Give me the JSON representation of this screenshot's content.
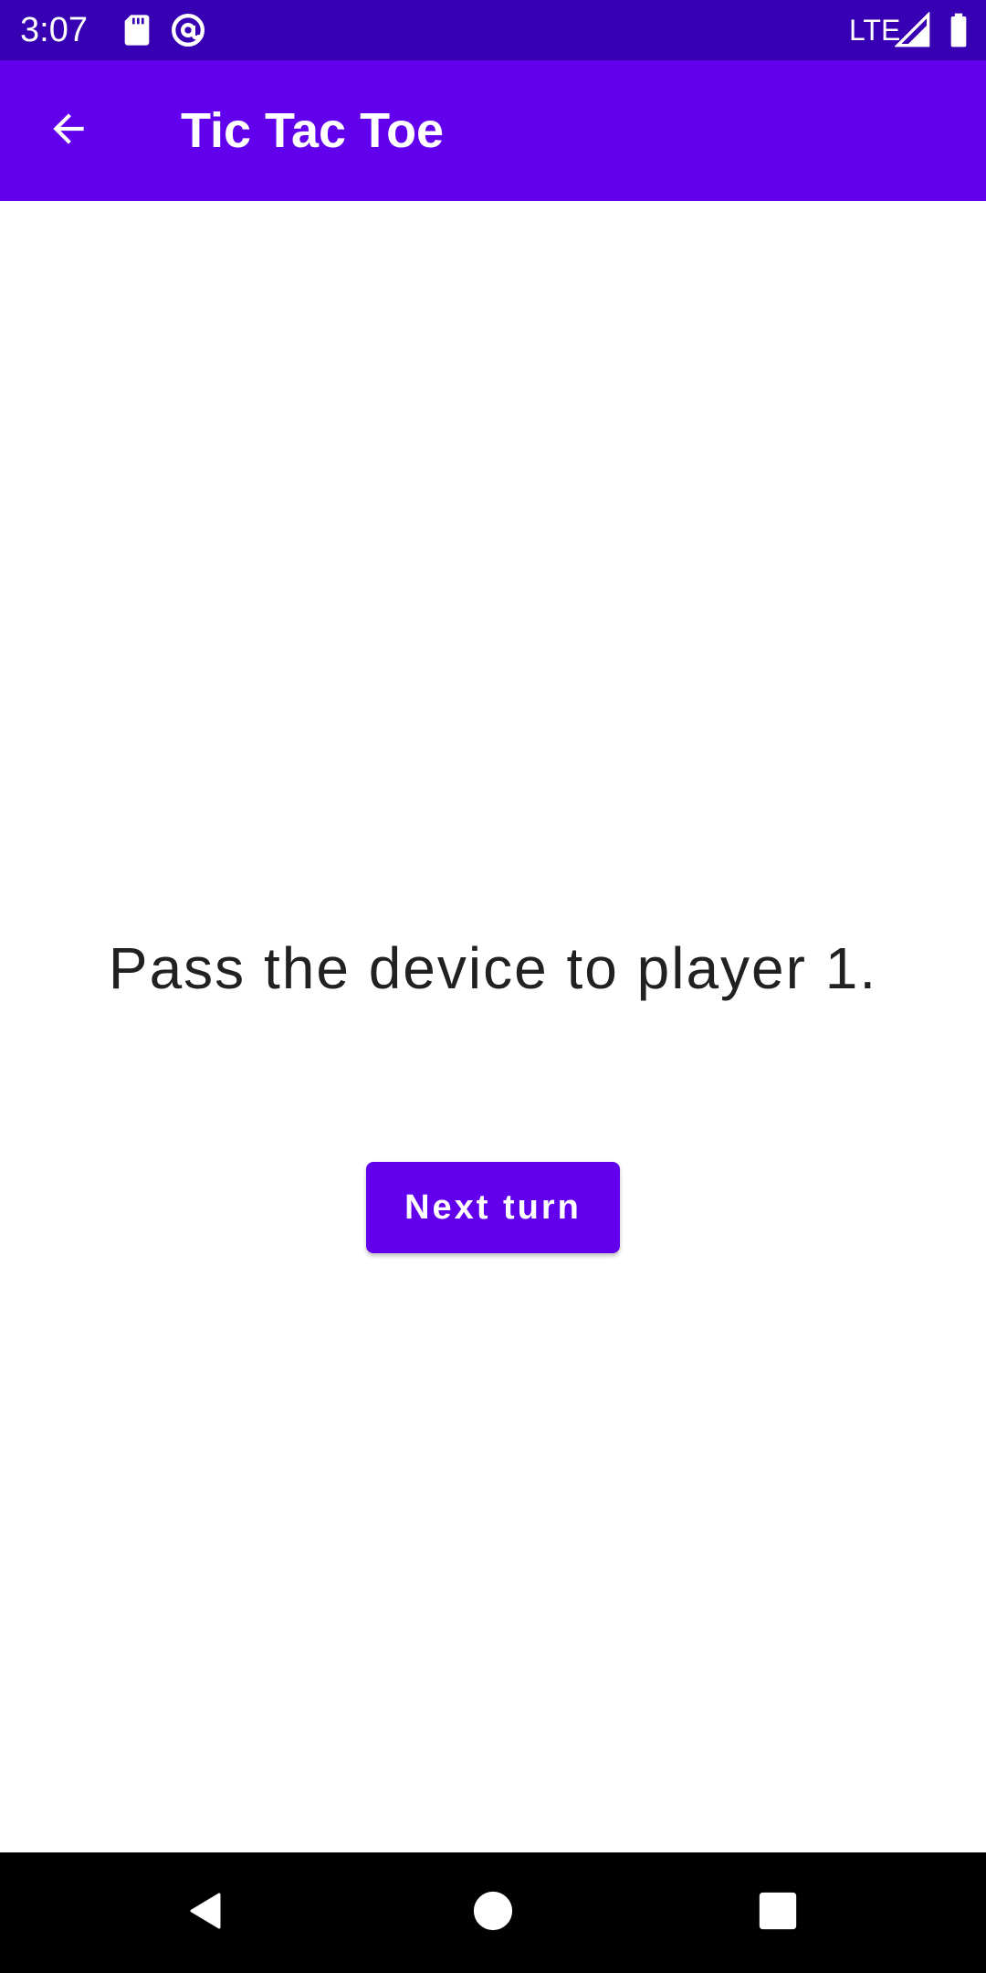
{
  "status_bar": {
    "time": "3:07",
    "network": "LTE",
    "icons": [
      "sd-card-icon",
      "at-sign-icon",
      "signal-icon",
      "battery-icon"
    ],
    "background": "#3700B3"
  },
  "app_bar": {
    "title": "Tic Tac Toe",
    "back_icon": "back-arrow-icon",
    "background": "#6200EE"
  },
  "main": {
    "message": "Pass the device to player 1.",
    "next_button_label": "Next turn",
    "button_color": "#6200EE"
  },
  "nav_bar": {
    "buttons": [
      "back-nav-icon",
      "home-nav-icon",
      "recents-nav-icon"
    ]
  }
}
